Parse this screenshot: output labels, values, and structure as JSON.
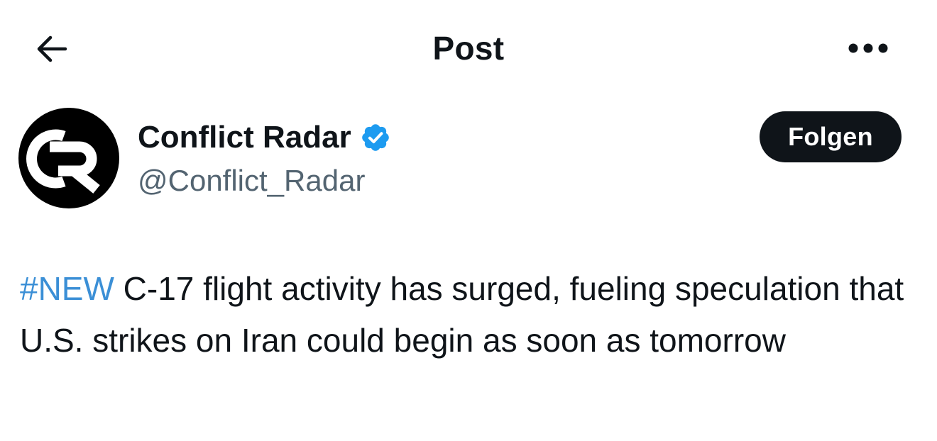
{
  "header": {
    "title": "Post",
    "back_icon": "arrow-left-icon",
    "more_icon": "more-horizontal-icon"
  },
  "author": {
    "display_name": "Conflict Radar",
    "handle": "@Conflict_Radar",
    "verified": true,
    "verified_color": "#1d9bf0",
    "avatar_icon": "conflict-radar-logo"
  },
  "follow_button": {
    "label": "Folgen"
  },
  "post": {
    "hashtag": "#NEW",
    "text": " C-17 flight activity has surged, fueling speculation that U.S. strikes on Iran could begin as soon as tomorrow"
  },
  "colors": {
    "text": "#0f1419",
    "secondary_text": "#536471",
    "link": "#1d9bf0",
    "button_bg": "#0f1419"
  }
}
